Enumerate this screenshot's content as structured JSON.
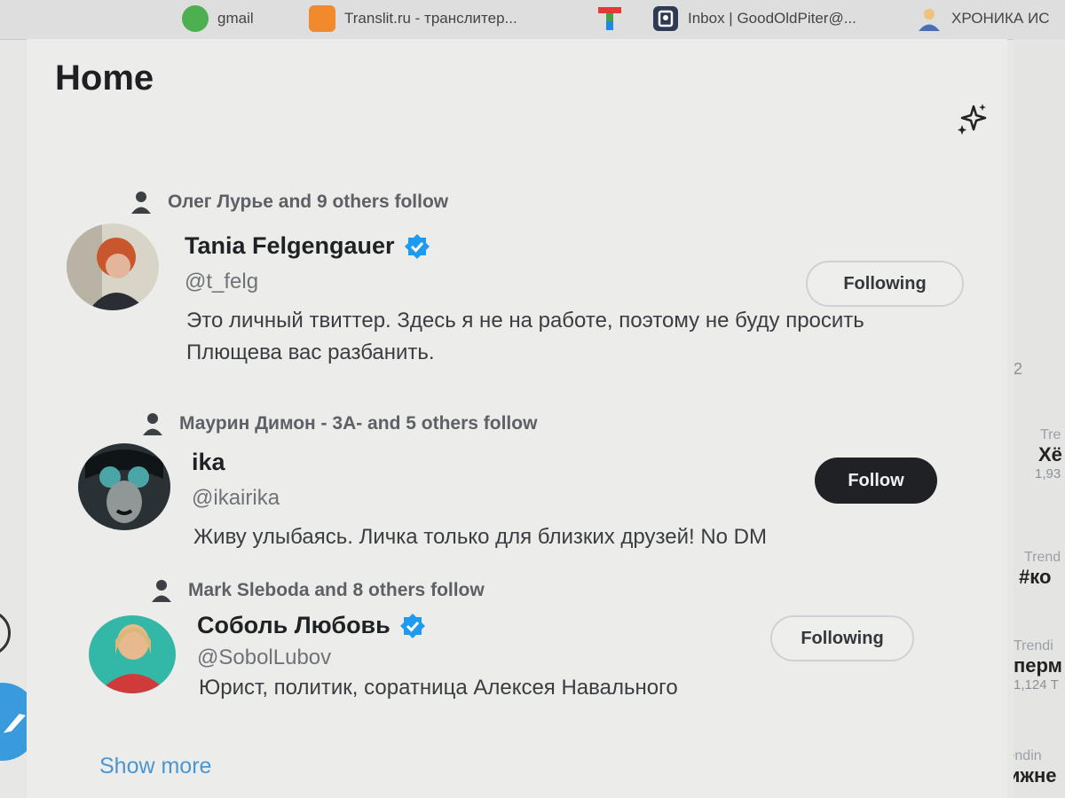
{
  "bookmarks": [
    {
      "label": "gmail",
      "icon": "gmail-icon",
      "color": "#4caf50"
    },
    {
      "label": "Translit.ru - транслитер...",
      "icon": "translit-icon",
      "color": "#f08a2c"
    },
    {
      "label": "",
      "icon": "t-logo-icon",
      "color": "#e53935"
    },
    {
      "label": "Inbox | GoodOldPiter@...",
      "icon": "inbox-icon",
      "color": "#2f3b55"
    },
    {
      "label": "ХРОНИКА ИС",
      "icon": "user-bookmark-icon",
      "color": "#4b6fb5"
    }
  ],
  "page": {
    "title": "Home",
    "sparkle_icon": "sparkle-icon",
    "show_more": "Show more"
  },
  "suggestions": [
    {
      "social": "Олег Лурье and 9 others follow",
      "name": "Tania Felgengauer",
      "verified": true,
      "handle": "@t_felg",
      "bio": "Это личный твиттер. Здесь я не на работе, поэтому не буду просить Плющева вас разбанить.",
      "button": "Following",
      "button_style": "outline"
    },
    {
      "social": "Маурин Димон - 3А- and 5 others follow",
      "name": "ika",
      "verified": false,
      "handle": "@ikairika",
      "bio": "Живу улыбаясь. Личка только для близких друзей! No DM",
      "button": "Follow",
      "button_style": "dark"
    },
    {
      "social": "Mark Sleboda and 8 others follow",
      "name": "Соболь Любовь",
      "verified": true,
      "handle": "@SobolLubov",
      "bio": "Юрист, политик, соратница Алексея Навального",
      "button": "Following",
      "button_style": "outline"
    }
  ],
  "sidebar_trends": [
    {
      "label": "",
      "title": "",
      "count": "2"
    },
    {
      "label": "Tre",
      "title": "Хё",
      "count": "1,93"
    },
    {
      "label": "Trend",
      "title": "#ко",
      "count": ""
    },
    {
      "label": "Trendi",
      "title": "перм",
      "count": "1,124 Т"
    },
    {
      "label": "Trendin",
      "title": "Нижне",
      "count": ""
    }
  ],
  "colors": {
    "accent": "#1d9bf0",
    "follow_button": "#1f2124",
    "link": "#4c96cf"
  }
}
